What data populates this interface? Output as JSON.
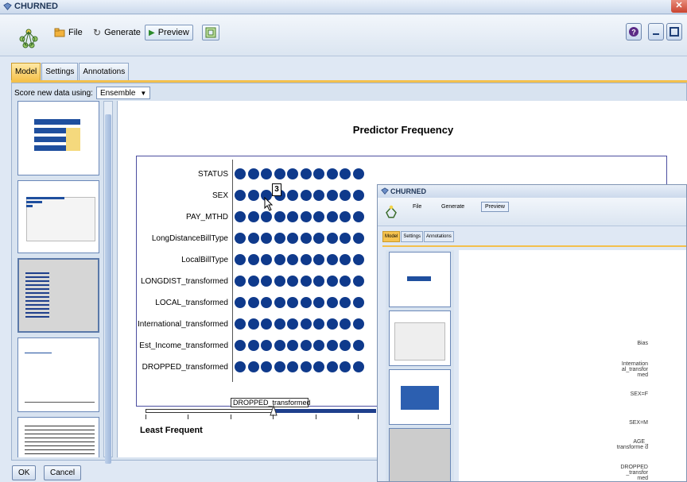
{
  "window": {
    "title": "CHURNED"
  },
  "toolbar": {
    "file": "File",
    "generate": "Generate",
    "preview": "Preview"
  },
  "tabs": [
    {
      "label": "Model",
      "active": true
    },
    {
      "label": "Settings"
    },
    {
      "label": "Annotations"
    }
  ],
  "score": {
    "label": "Score new data using:",
    "value": "Ensemble"
  },
  "chart_data": {
    "type": "scatter",
    "title": "Predictor Frequency",
    "categories": [
      "STATUS",
      "SEX",
      "PAY_MTHD",
      "LongDistanceBillType",
      "LocalBillType",
      "LONGDIST_transformed",
      "LOCAL_transformed",
      "International_transformed",
      "Est_Income_transformed",
      "DROPPED_transformed"
    ],
    "dots_per_row": 10,
    "xlabel": "Least Frequent"
  },
  "tooltip": {
    "number": "3",
    "label": "DROPPED_transformed"
  },
  "buttons": {
    "ok": "OK",
    "cancel": "Cancel"
  },
  "overlay": {
    "title": "CHURNED",
    "file": "File",
    "generate": "Generate",
    "preview": "Preview",
    "tabs": [
      "Model",
      "Settings",
      "Annotations"
    ],
    "net_labels": [
      "Bias",
      "Internation al_transfor med",
      "SEX=F",
      "SEX=M",
      "AGE_ transforme d",
      "DROPPED _transfor med"
    ]
  },
  "colors": {
    "dot": "#0f3a8c",
    "accent_tab": "#f6c34f"
  }
}
